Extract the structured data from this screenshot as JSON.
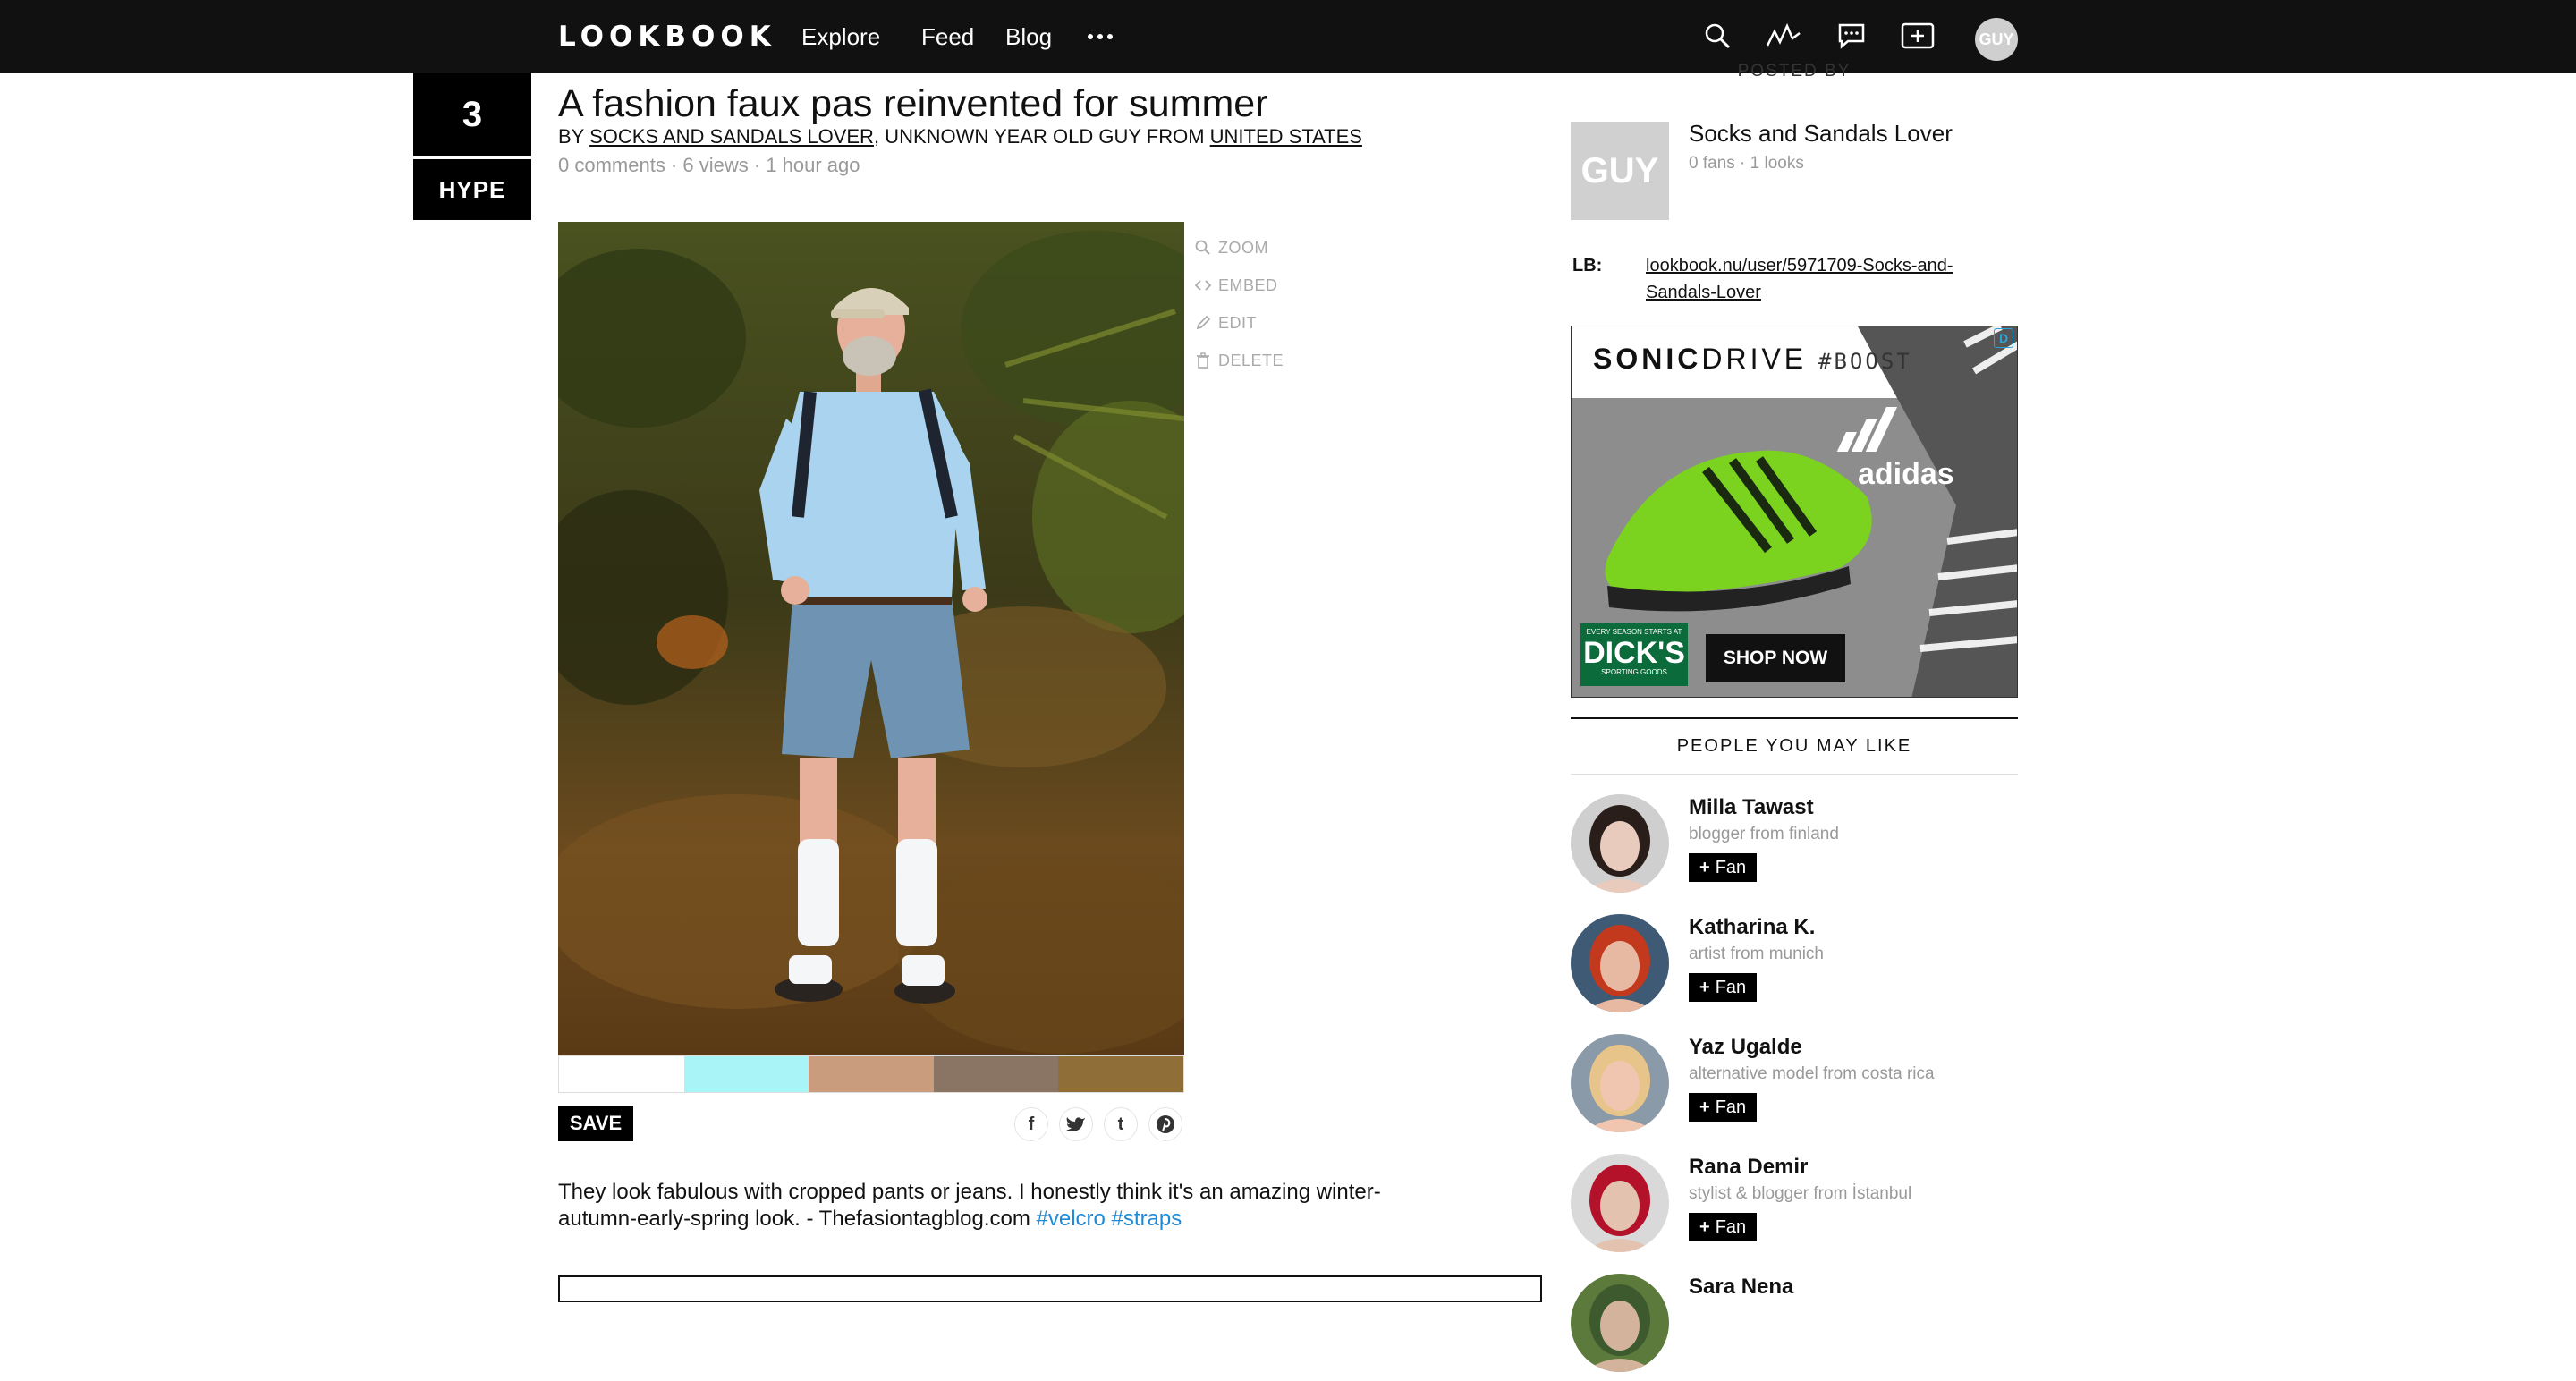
{
  "nav": {
    "logo": "LOOKBOOK",
    "items": [
      "Explore",
      "Feed",
      "Blog"
    ],
    "more_icon": "ellipsis-icon",
    "icons": [
      "search-icon",
      "activity-icon",
      "messages-icon",
      "add-post-icon"
    ],
    "avatar_text": "GUY"
  },
  "hype": {
    "count": "3",
    "label": "HYPE"
  },
  "post": {
    "title": "A fashion faux pas reinvented for summer",
    "by_prefix": "BY ",
    "author": "SOCKS AND SANDALS LOVER",
    "by_middle": ", UNKNOWN YEAR OLD GUY FROM ",
    "country": "UNITED STATES",
    "meta": "0 comments · 6 views · 1 hour ago",
    "actions": [
      {
        "label": "ZOOM",
        "icon": "zoom-icon"
      },
      {
        "label": "EMBED",
        "icon": "embed-icon"
      },
      {
        "label": "EDIT",
        "icon": "pencil-icon"
      },
      {
        "label": "DELETE",
        "icon": "trash-icon"
      }
    ],
    "swatches": [
      "#ffffff",
      "#a8f4f6",
      "#c89c7c",
      "#8a7464",
      "#8f6e38"
    ],
    "save_label": "SAVE",
    "share_icons": [
      "facebook-icon",
      "twitter-icon",
      "tumblr-icon",
      "pinterest-icon"
    ],
    "description": "They look fabulous with cropped pants or jeans. I honestly think it's an amazing winter-autumn-early-spring look. - Thefasiontagblog.com ",
    "tags": [
      "#velcro",
      "#straps"
    ]
  },
  "sidebar": {
    "posted_by": "POSTED BY",
    "author_thumb": "GUY",
    "author_name": "Socks and Sandals Lover",
    "author_stats": "0 fans · 1 looks",
    "lb_label": "LB:",
    "lb_link": "lookbook.nu/user/5971709-Socks-and-Sandals-Lover",
    "ad": {
      "title_bold": "SONIC",
      "title_rest": "DRIVE ",
      "hashtag": "#BOOST",
      "brand": "adidas",
      "retailer_small": "EVERY SEASON STARTS AT",
      "retailer": "DICK'S",
      "retailer_sub": "SPORTING GOODS",
      "cta": "SHOP NOW",
      "choice": "D"
    },
    "pymk_title": "PEOPLE YOU MAY LIKE",
    "fan_label": "Fan",
    "people": [
      {
        "name": "Milla Tawast",
        "desc": "blogger from finland",
        "hair": "#2a1e1a",
        "skin": "#e8cbbd",
        "bg": "#cfcfcf"
      },
      {
        "name": "Katharina K.",
        "desc": "artist from munich",
        "hair": "#c2391e",
        "skin": "#e7b9a2",
        "bg": "#3e5a74"
      },
      {
        "name": "Yaz Ugalde",
        "desc": "alternative model from costa rica",
        "hair": "#e7c48a",
        "skin": "#f0c6b0",
        "bg": "#8a9aa8"
      },
      {
        "name": "Rana Demir",
        "desc": "stylist & blogger from İstanbul",
        "hair": "#b3122a",
        "skin": "#e4c2b0",
        "bg": "#d9d9d9"
      },
      {
        "name": "Sara Nena",
        "desc": "",
        "hair": "#3c5a2e",
        "skin": "#d4b39c",
        "bg": "#5c7a3c"
      }
    ]
  }
}
